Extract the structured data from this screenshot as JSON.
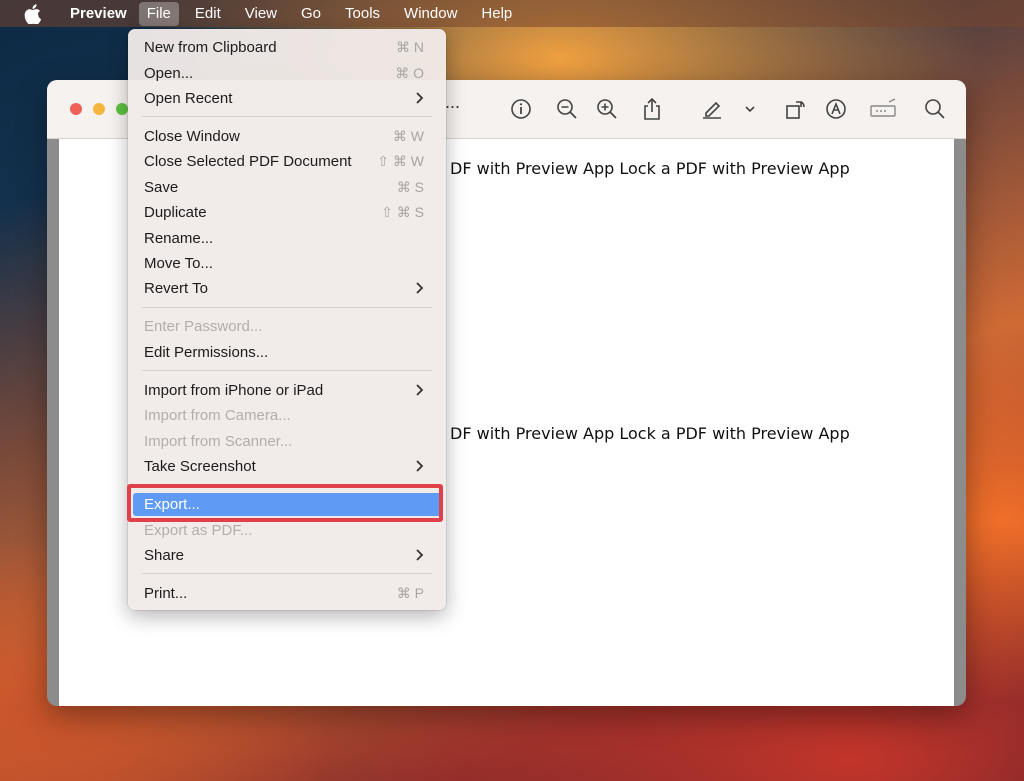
{
  "menubar": {
    "apple_icon": "apple-icon",
    "app_name": "Preview",
    "items": [
      "File",
      "Edit",
      "View",
      "Go",
      "Tools",
      "Window",
      "Help"
    ]
  },
  "window": {
    "title_ellipsis": "...",
    "toolbar_icons": [
      "info-icon",
      "zoom-out-icon",
      "zoom-in-icon",
      "share-icon",
      "highlight-icon",
      "chevron-down-icon",
      "rotate-icon",
      "markup-icon",
      "form-fill-icon",
      "search-icon"
    ],
    "doc_line_1": "DF with Preview App Lock a PDF with Preview App",
    "doc_line_2": "DF with Preview App Lock a PDF with Preview App"
  },
  "file_menu": {
    "new_from_clipboard": {
      "label": "New from Clipboard",
      "shortcut": "⌘ N"
    },
    "open": {
      "label": "Open...",
      "shortcut": "⌘ O"
    },
    "open_recent": {
      "label": "Open Recent"
    },
    "close_window": {
      "label": "Close Window",
      "shortcut": "⌘ W"
    },
    "close_selected": {
      "label": "Close Selected PDF Document",
      "shortcut": "⇧ ⌘ W"
    },
    "save": {
      "label": "Save",
      "shortcut": "⌘ S"
    },
    "duplicate": {
      "label": "Duplicate",
      "shortcut": "⇧ ⌘ S"
    },
    "rename": {
      "label": "Rename..."
    },
    "move_to": {
      "label": "Move To..."
    },
    "revert_to": {
      "label": "Revert To"
    },
    "enter_password": {
      "label": "Enter Password..."
    },
    "edit_permissions": {
      "label": "Edit Permissions..."
    },
    "import_iphone": {
      "label": "Import from iPhone or iPad"
    },
    "import_camera": {
      "label": "Import from Camera..."
    },
    "import_scanner": {
      "label": "Import from Scanner..."
    },
    "take_screenshot": {
      "label": "Take Screenshot"
    },
    "export": {
      "label": "Export..."
    },
    "export_pdf": {
      "label": "Export as PDF..."
    },
    "share": {
      "label": "Share"
    },
    "print": {
      "label": "Print...",
      "shortcut": "⌘ P"
    }
  },
  "colors": {
    "highlight": "#5f9bf5",
    "annotation_outline": "#e0404a"
  }
}
